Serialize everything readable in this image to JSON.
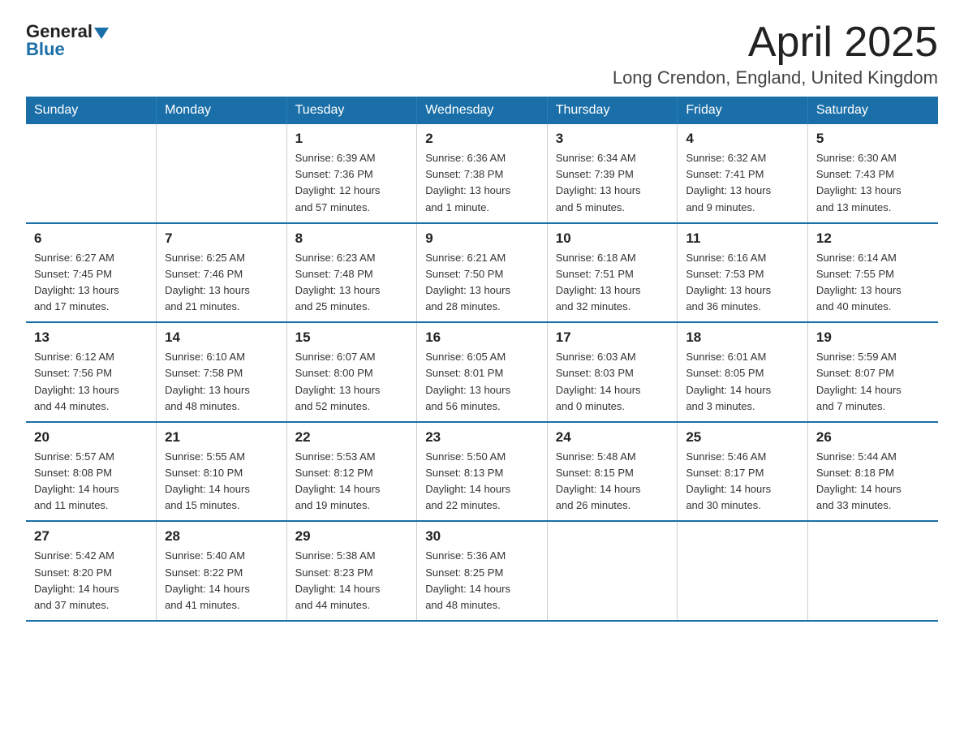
{
  "logo": {
    "general": "General",
    "blue": "Blue"
  },
  "title": {
    "month": "April 2025",
    "location": "Long Crendon, England, United Kingdom"
  },
  "days_of_week": [
    "Sunday",
    "Monday",
    "Tuesday",
    "Wednesday",
    "Thursday",
    "Friday",
    "Saturday"
  ],
  "weeks": [
    [
      {
        "day": "",
        "info": ""
      },
      {
        "day": "",
        "info": ""
      },
      {
        "day": "1",
        "info": "Sunrise: 6:39 AM\nSunset: 7:36 PM\nDaylight: 12 hours\nand 57 minutes."
      },
      {
        "day": "2",
        "info": "Sunrise: 6:36 AM\nSunset: 7:38 PM\nDaylight: 13 hours\nand 1 minute."
      },
      {
        "day": "3",
        "info": "Sunrise: 6:34 AM\nSunset: 7:39 PM\nDaylight: 13 hours\nand 5 minutes."
      },
      {
        "day": "4",
        "info": "Sunrise: 6:32 AM\nSunset: 7:41 PM\nDaylight: 13 hours\nand 9 minutes."
      },
      {
        "day": "5",
        "info": "Sunrise: 6:30 AM\nSunset: 7:43 PM\nDaylight: 13 hours\nand 13 minutes."
      }
    ],
    [
      {
        "day": "6",
        "info": "Sunrise: 6:27 AM\nSunset: 7:45 PM\nDaylight: 13 hours\nand 17 minutes."
      },
      {
        "day": "7",
        "info": "Sunrise: 6:25 AM\nSunset: 7:46 PM\nDaylight: 13 hours\nand 21 minutes."
      },
      {
        "day": "8",
        "info": "Sunrise: 6:23 AM\nSunset: 7:48 PM\nDaylight: 13 hours\nand 25 minutes."
      },
      {
        "day": "9",
        "info": "Sunrise: 6:21 AM\nSunset: 7:50 PM\nDaylight: 13 hours\nand 28 minutes."
      },
      {
        "day": "10",
        "info": "Sunrise: 6:18 AM\nSunset: 7:51 PM\nDaylight: 13 hours\nand 32 minutes."
      },
      {
        "day": "11",
        "info": "Sunrise: 6:16 AM\nSunset: 7:53 PM\nDaylight: 13 hours\nand 36 minutes."
      },
      {
        "day": "12",
        "info": "Sunrise: 6:14 AM\nSunset: 7:55 PM\nDaylight: 13 hours\nand 40 minutes."
      }
    ],
    [
      {
        "day": "13",
        "info": "Sunrise: 6:12 AM\nSunset: 7:56 PM\nDaylight: 13 hours\nand 44 minutes."
      },
      {
        "day": "14",
        "info": "Sunrise: 6:10 AM\nSunset: 7:58 PM\nDaylight: 13 hours\nand 48 minutes."
      },
      {
        "day": "15",
        "info": "Sunrise: 6:07 AM\nSunset: 8:00 PM\nDaylight: 13 hours\nand 52 minutes."
      },
      {
        "day": "16",
        "info": "Sunrise: 6:05 AM\nSunset: 8:01 PM\nDaylight: 13 hours\nand 56 minutes."
      },
      {
        "day": "17",
        "info": "Sunrise: 6:03 AM\nSunset: 8:03 PM\nDaylight: 14 hours\nand 0 minutes."
      },
      {
        "day": "18",
        "info": "Sunrise: 6:01 AM\nSunset: 8:05 PM\nDaylight: 14 hours\nand 3 minutes."
      },
      {
        "day": "19",
        "info": "Sunrise: 5:59 AM\nSunset: 8:07 PM\nDaylight: 14 hours\nand 7 minutes."
      }
    ],
    [
      {
        "day": "20",
        "info": "Sunrise: 5:57 AM\nSunset: 8:08 PM\nDaylight: 14 hours\nand 11 minutes."
      },
      {
        "day": "21",
        "info": "Sunrise: 5:55 AM\nSunset: 8:10 PM\nDaylight: 14 hours\nand 15 minutes."
      },
      {
        "day": "22",
        "info": "Sunrise: 5:53 AM\nSunset: 8:12 PM\nDaylight: 14 hours\nand 19 minutes."
      },
      {
        "day": "23",
        "info": "Sunrise: 5:50 AM\nSunset: 8:13 PM\nDaylight: 14 hours\nand 22 minutes."
      },
      {
        "day": "24",
        "info": "Sunrise: 5:48 AM\nSunset: 8:15 PM\nDaylight: 14 hours\nand 26 minutes."
      },
      {
        "day": "25",
        "info": "Sunrise: 5:46 AM\nSunset: 8:17 PM\nDaylight: 14 hours\nand 30 minutes."
      },
      {
        "day": "26",
        "info": "Sunrise: 5:44 AM\nSunset: 8:18 PM\nDaylight: 14 hours\nand 33 minutes."
      }
    ],
    [
      {
        "day": "27",
        "info": "Sunrise: 5:42 AM\nSunset: 8:20 PM\nDaylight: 14 hours\nand 37 minutes."
      },
      {
        "day": "28",
        "info": "Sunrise: 5:40 AM\nSunset: 8:22 PM\nDaylight: 14 hours\nand 41 minutes."
      },
      {
        "day": "29",
        "info": "Sunrise: 5:38 AM\nSunset: 8:23 PM\nDaylight: 14 hours\nand 44 minutes."
      },
      {
        "day": "30",
        "info": "Sunrise: 5:36 AM\nSunset: 8:25 PM\nDaylight: 14 hours\nand 48 minutes."
      },
      {
        "day": "",
        "info": ""
      },
      {
        "day": "",
        "info": ""
      },
      {
        "day": "",
        "info": ""
      }
    ]
  ]
}
